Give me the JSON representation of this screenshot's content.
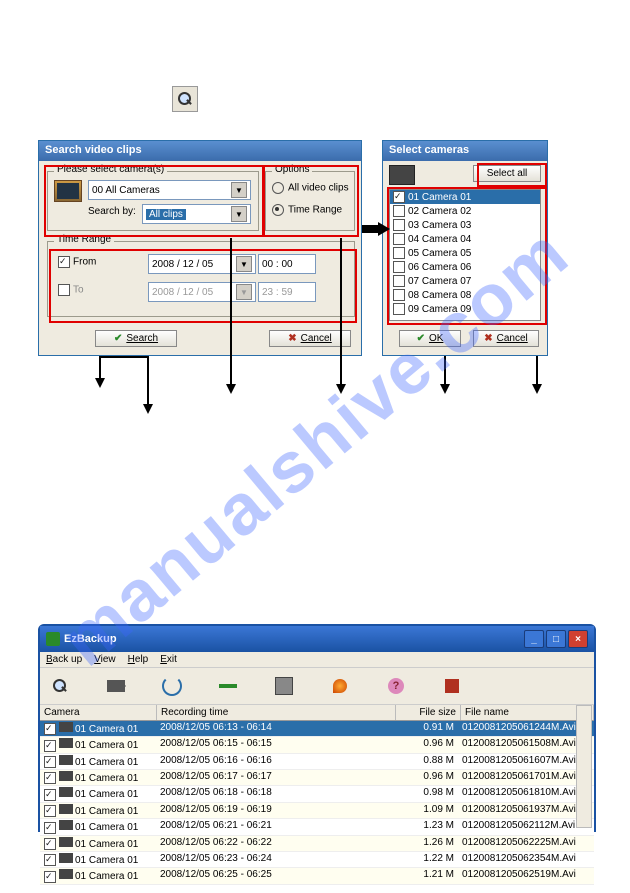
{
  "search_dialog": {
    "title": "Search video clips",
    "group_camera": "Please select camera(s)",
    "camera_selected": "00 All Cameras",
    "search_by_label": "Search by:",
    "search_by_value": "All clips",
    "group_options": "Options",
    "opt_all": "All video clips",
    "opt_time": "Time Range",
    "group_time": "Time Range",
    "from_label": "From",
    "to_label": "To",
    "from_date": "2008 / 12 / 05",
    "from_time": "00 : 00",
    "to_date": "2008 / 12 / 05",
    "to_time": "23 : 59",
    "btn_search": "Search",
    "btn_cancel": "Cancel"
  },
  "select_cams": {
    "title": "Select cameras",
    "btn_selectall": "Select all",
    "btn_ok": "OK",
    "btn_cancel": "Cancel",
    "cameras": [
      {
        "label": "01 Camera 01",
        "sel": true
      },
      {
        "label": "02 Camera 02",
        "sel": false
      },
      {
        "label": "03 Camera 03",
        "sel": false
      },
      {
        "label": "04 Camera 04",
        "sel": false
      },
      {
        "label": "05 Camera 05",
        "sel": false
      },
      {
        "label": "06 Camera 06",
        "sel": false
      },
      {
        "label": "07 Camera 07",
        "sel": false
      },
      {
        "label": "08 Camera 08",
        "sel": false
      },
      {
        "label": "09 Camera 09",
        "sel": false
      }
    ]
  },
  "ezbackup": {
    "title": "EzBackup",
    "menu": [
      "Back up",
      "View",
      "Help",
      "Exit"
    ],
    "columns": {
      "camera": "Camera",
      "time": "Recording time",
      "size": "File size",
      "name": "File name"
    },
    "rows": [
      {
        "cam": "01 Camera 01",
        "time": "2008/12/05 06:13 - 06:14",
        "size": "0.91 M",
        "name": "0120081205061244M.Avi",
        "sel": true
      },
      {
        "cam": "01 Camera 01",
        "time": "2008/12/05 06:15 - 06:15",
        "size": "0.96 M",
        "name": "0120081205061508M.Avi",
        "sel": false
      },
      {
        "cam": "01 Camera 01",
        "time": "2008/12/05 06:16 - 06:16",
        "size": "0.88 M",
        "name": "0120081205061607M.Avi",
        "sel": false
      },
      {
        "cam": "01 Camera 01",
        "time": "2008/12/05 06:17 - 06:17",
        "size": "0.96 M",
        "name": "0120081205061701M.Avi",
        "sel": false
      },
      {
        "cam": "01 Camera 01",
        "time": "2008/12/05 06:18 - 06:18",
        "size": "0.98 M",
        "name": "0120081205061810M.Avi",
        "sel": false
      },
      {
        "cam": "01 Camera 01",
        "time": "2008/12/05 06:19 - 06:19",
        "size": "1.09 M",
        "name": "0120081205061937M.Avi",
        "sel": false
      },
      {
        "cam": "01 Camera 01",
        "time": "2008/12/05 06:21 - 06:21",
        "size": "1.23 M",
        "name": "0120081205062112M.Avi",
        "sel": false
      },
      {
        "cam": "01 Camera 01",
        "time": "2008/12/05 06:22 - 06:22",
        "size": "1.26 M",
        "name": "0120081205062225M.Avi",
        "sel": false
      },
      {
        "cam": "01 Camera 01",
        "time": "2008/12/05 06:23 - 06:24",
        "size": "1.22 M",
        "name": "0120081205062354M.Avi",
        "sel": false
      },
      {
        "cam": "01 Camera 01",
        "time": "2008/12/05 06:25 - 06:25",
        "size": "1.21 M",
        "name": "0120081205062519M.Avi",
        "sel": false
      }
    ]
  }
}
